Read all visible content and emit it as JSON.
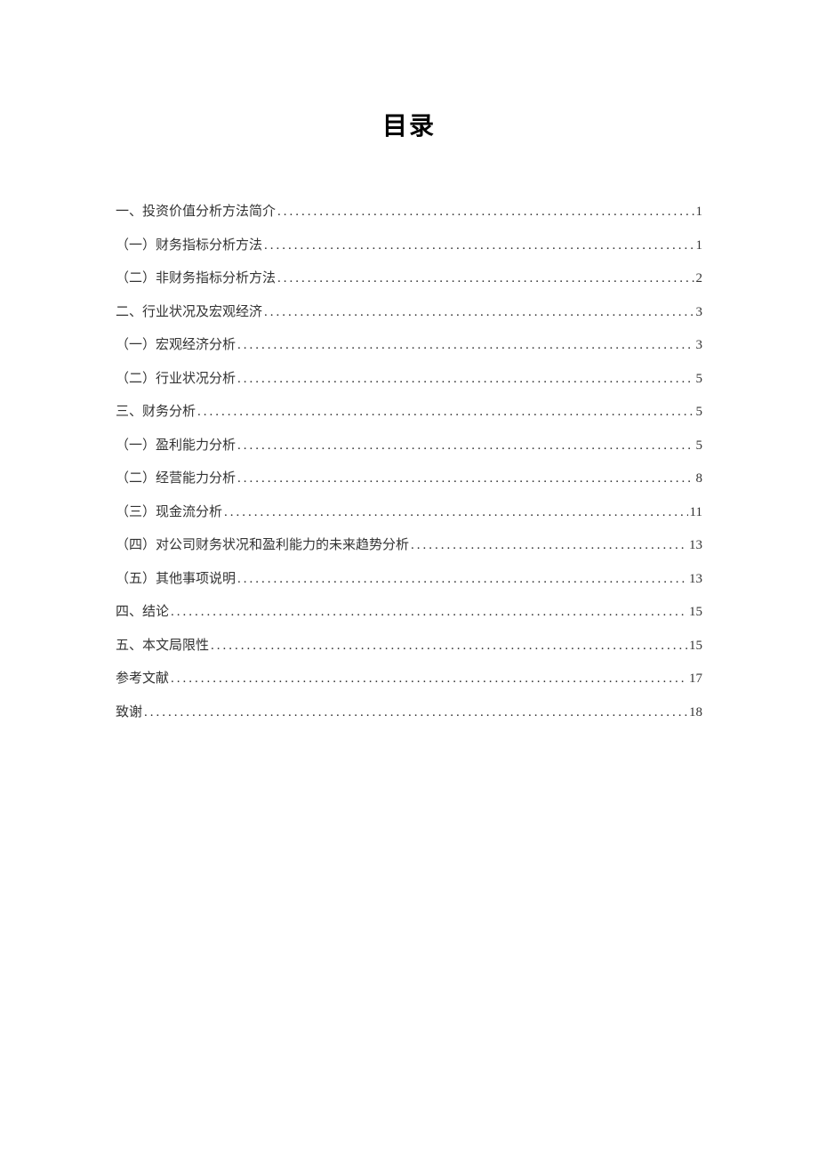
{
  "title": "目录",
  "toc": [
    {
      "label": "一、投资价值分析方法简介",
      "page": "1"
    },
    {
      "label": "（一）财务指标分析方法",
      "page": "1"
    },
    {
      "label": "（二）非财务指标分析方法",
      "page": "2"
    },
    {
      "label": "二、行业状况及宏观经济",
      "page": "3"
    },
    {
      "label": "（一）宏观经济分析",
      "page": "3"
    },
    {
      "label": "（二）行业状况分析",
      "page": "5"
    },
    {
      "label": "三、财务分析",
      "page": "5"
    },
    {
      "label": "（一）盈利能力分析",
      "page": "5"
    },
    {
      "label": "（二）经营能力分析",
      "page": "8"
    },
    {
      "label": "（三）现金流分析",
      "page": "11"
    },
    {
      "label": "（四）对公司财务状况和盈利能力的未来趋势分析",
      "page": "13"
    },
    {
      "label": "（五）其他事项说明",
      "page": "13"
    },
    {
      "label": "四、结论",
      "page": "15"
    },
    {
      "label": "五、本文局限性",
      "page": "15"
    },
    {
      "label": "参考文献",
      "page": "17"
    },
    {
      "label": "致谢",
      "page": "18"
    }
  ]
}
